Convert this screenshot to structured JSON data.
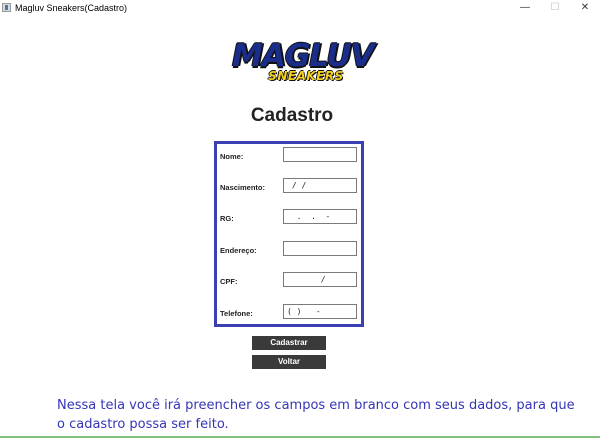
{
  "window": {
    "title": "Magluv Sneakers(Cadastro)",
    "controls": {
      "minimize": "—",
      "maximize": "☐",
      "close": "✕"
    }
  },
  "logo": {
    "main": "MAGLUV",
    "sub": "SNEAKERS"
  },
  "heading": "Cadastro",
  "form": {
    "fields": [
      {
        "label": "Nome:",
        "value": ""
      },
      {
        "label": "Nascimento:",
        "value": " / /"
      },
      {
        "label": "RG:",
        "value": "  .  .  -"
      },
      {
        "label": "Endereço:",
        "value": ""
      },
      {
        "label": "CPF:",
        "value": "       /"
      },
      {
        "label": "Telefone:",
        "value": "( )   -"
      }
    ]
  },
  "buttons": {
    "cadastrar": "Cadastrar",
    "voltar": "Voltar"
  },
  "info_text": "Nessa tela você irá preencher os campos em branco com seus dados, para que o cadastro possa ser feito."
}
